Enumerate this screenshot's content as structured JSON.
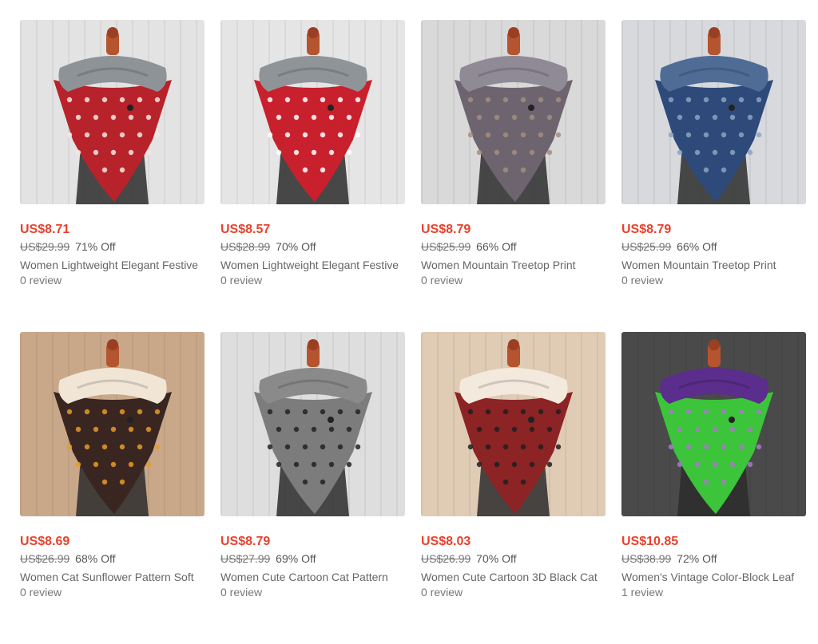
{
  "products": [
    {
      "price": "US$8.71",
      "old_price": "US$29.99",
      "discount": "71% Off",
      "title": "Women Lightweight Elegant Festive",
      "reviews": "0 review",
      "image_icon": "red-snowflake-scarf-image",
      "colors": {
        "bg": "#e3e3e3",
        "scarf": "#b8222b",
        "collar": "#8e9398",
        "motif": "#f2e7e2"
      }
    },
    {
      "price": "US$8.57",
      "old_price": "US$28.99",
      "discount": "70% Off",
      "title": "Women Lightweight Elegant Festive",
      "reviews": "0 review",
      "image_icon": "red-reindeer-scarf-image",
      "colors": {
        "bg": "#e5e5e5",
        "scarf": "#c8202c",
        "collar": "#8f9499",
        "motif": "#ffffff"
      }
    },
    {
      "price": "US$8.79",
      "old_price": "US$25.99",
      "discount": "66% Off",
      "title": "Women Mountain Treetop Print",
      "reviews": "0 review",
      "image_icon": "grey-mountain-scarf-image",
      "colors": {
        "bg": "#d9d9d9",
        "scarf": "#6e6470",
        "collar": "#908a96",
        "motif": "#a48e7a"
      }
    },
    {
      "price": "US$8.79",
      "old_price": "US$25.99",
      "discount": "66% Off",
      "title": "Women Mountain Treetop Print",
      "reviews": "0 review",
      "image_icon": "blue-mountain-scarf-image",
      "colors": {
        "bg": "#d7d9dc",
        "scarf": "#2d4a7a",
        "collar": "#4f6c96",
        "motif": "#8fa2bf"
      }
    },
    {
      "price": "US$8.69",
      "old_price": "US$26.99",
      "discount": "68% Off",
      "title": "Women Cat Sunflower Pattern Soft",
      "reviews": "0 review",
      "image_icon": "brown-cat-sunflower-scarf-image",
      "colors": {
        "bg": "#c9a88a",
        "scarf": "#3a2620",
        "collar": "#f1e6d6",
        "motif": "#e79a2a"
      }
    },
    {
      "price": "US$8.79",
      "old_price": "US$27.99",
      "discount": "69% Off",
      "title": "Women Cute Cartoon Cat Pattern",
      "reviews": "0 review",
      "image_icon": "grey-black-cat-scarf-image",
      "colors": {
        "bg": "#dedede",
        "scarf": "#7c7c7c",
        "collar": "#8a8a8a",
        "motif": "#222222"
      }
    },
    {
      "price": "US$8.03",
      "old_price": "US$26.99",
      "discount": "70% Off",
      "title": "Women Cute Cartoon 3D Black Cat",
      "reviews": "0 review",
      "image_icon": "red-christmas-cat-scarf-image",
      "colors": {
        "bg": "#e0cbb5",
        "scarf": "#8c2325",
        "collar": "#f3e9dc",
        "motif": "#1e1e1e"
      }
    },
    {
      "price": "US$10.85",
      "old_price": "US$38.99",
      "discount": "72% Off",
      "title": "Women's Vintage Color-Block Leaf",
      "reviews": "1 review",
      "image_icon": "green-purple-leaf-scarf-image",
      "colors": {
        "bg": "#4a4a4a",
        "scarf": "#3cc43a",
        "collar": "#5b2d8c",
        "motif": "#a779c9"
      }
    }
  ]
}
